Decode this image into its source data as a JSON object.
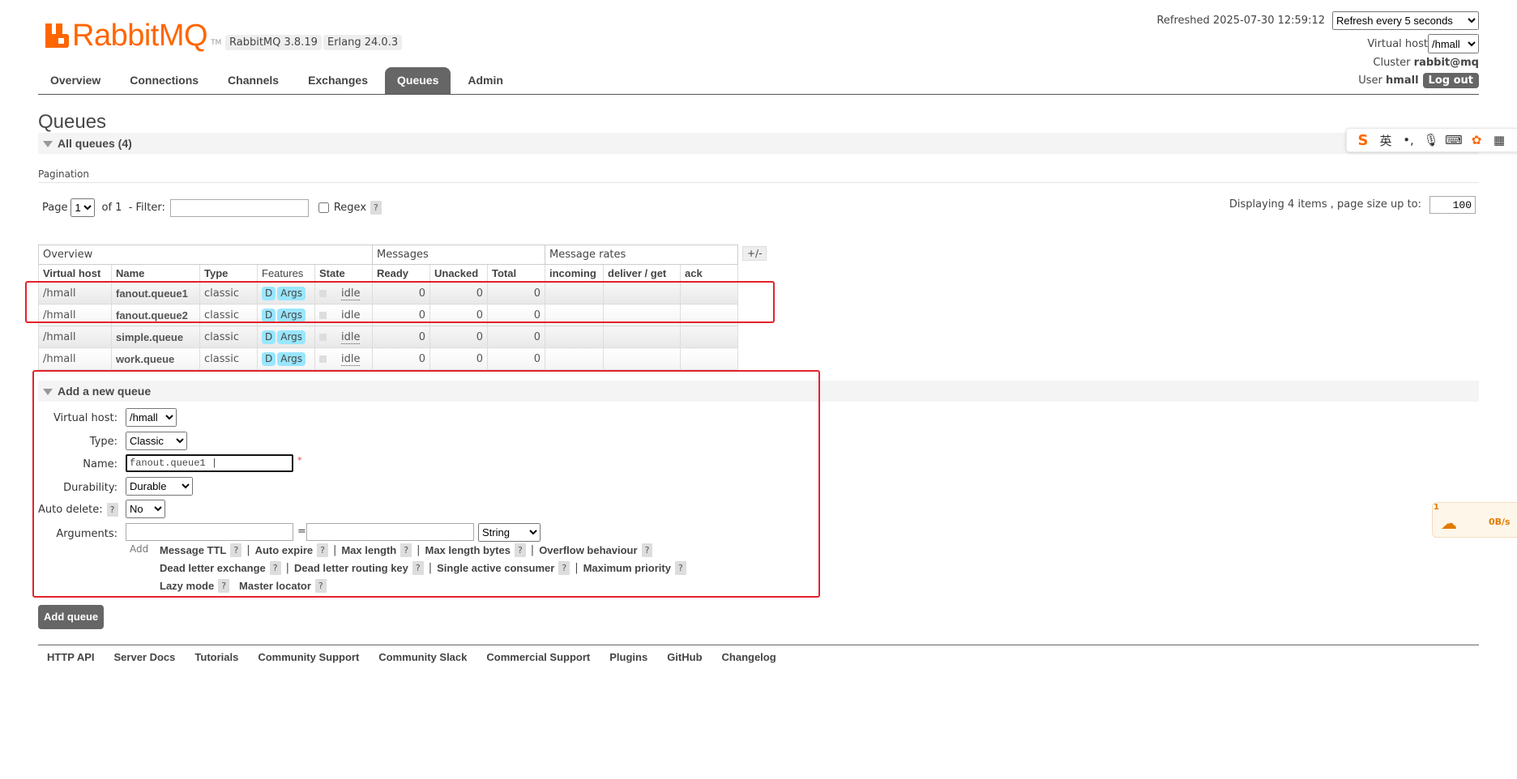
{
  "brand": {
    "name": "RabbitMQ",
    "trademark": "TM",
    "rabbitmq_version": "RabbitMQ 3.8.19",
    "erlang_version": "Erlang 24.0.3",
    "accent_color": "#ff6600"
  },
  "nav": {
    "tabs": [
      {
        "label": "Overview",
        "active": false
      },
      {
        "label": "Connections",
        "active": false
      },
      {
        "label": "Channels",
        "active": false
      },
      {
        "label": "Exchanges",
        "active": false
      },
      {
        "label": "Queues",
        "active": true
      },
      {
        "label": "Admin",
        "active": false
      }
    ]
  },
  "header_right": {
    "refreshed": "Refreshed 2025-07-30 12:59:12",
    "refresh_option": "Refresh every 5 seconds",
    "vhost_label": "Virtual host",
    "vhost_value": "/hmall",
    "cluster_label": "Cluster",
    "cluster_value": "rabbit@mq",
    "user_label": "User",
    "user_value": "hmall",
    "logout_label": "Log out"
  },
  "page": {
    "title": "Queues",
    "all_queues": "All queues (4)"
  },
  "pagination": {
    "label": "Pagination",
    "page_label": "Page",
    "page_value": "1",
    "of_label": "of 1",
    "filter_label": "- Filter:",
    "filter_value": "",
    "regex_label": "Regex",
    "help": "?",
    "displaying": "Displaying 4 items , page size up to:",
    "page_size": "100"
  },
  "table": {
    "group_headers": [
      "Overview",
      "Messages",
      "Message rates"
    ],
    "plus_minus": "+/-",
    "columns": [
      "Virtual host",
      "Name",
      "Type",
      "Features",
      "State",
      "Ready",
      "Unacked",
      "Total",
      "incoming",
      "deliver / get",
      "ack"
    ],
    "feature_d": "D",
    "feature_args": "Args",
    "rows": [
      {
        "vhost": "/hmall",
        "name": "fanout.queue1",
        "type": "classic",
        "state": "idle",
        "ready": "0",
        "unacked": "0",
        "total": "0"
      },
      {
        "vhost": "/hmall",
        "name": "fanout.queue2",
        "type": "classic",
        "state": "idle",
        "ready": "0",
        "unacked": "0",
        "total": "0"
      },
      {
        "vhost": "/hmall",
        "name": "simple.queue",
        "type": "classic",
        "state": "idle",
        "ready": "0",
        "unacked": "0",
        "total": "0"
      },
      {
        "vhost": "/hmall",
        "name": "work.queue",
        "type": "classic",
        "state": "idle",
        "ready": "0",
        "unacked": "0",
        "total": "0"
      }
    ]
  },
  "add_queue": {
    "section_title": "Add a new queue",
    "vhost_label": "Virtual host:",
    "vhost_value": "/hmall",
    "type_label": "Type:",
    "type_value": "Classic",
    "name_label": "Name:",
    "name_value": "fanout.queue1 |",
    "required_mark": "*",
    "durability_label": "Durability:",
    "durability_value": "Durable",
    "auto_delete_label": "Auto delete:",
    "auto_delete_value": "No",
    "arguments_label": "Arguments:",
    "equals": "=",
    "arg_type_value": "String",
    "add_label": "Add",
    "arg_options_row1": [
      "Message TTL",
      "Auto expire",
      "Max length",
      "Max length bytes",
      "Overflow behaviour"
    ],
    "arg_options_row2": [
      "Dead letter exchange",
      "Dead letter routing key",
      "Single active consumer",
      "Maximum priority"
    ],
    "arg_options_row3": [
      "Lazy mode",
      "Master locator"
    ],
    "submit_label": "Add queue"
  },
  "footer": {
    "links": [
      "HTTP API",
      "Server Docs",
      "Tutorials",
      "Community Support",
      "Community Slack",
      "Commercial Support",
      "Plugins",
      "GitHub",
      "Changelog"
    ]
  },
  "ime_toolbar": {
    "icons": [
      "sogou-logo-icon",
      "english-mode-icon",
      "punctuation-icon",
      "microphone-icon",
      "keyboard-icon",
      "skin-icon",
      "grid-menu-icon"
    ],
    "english_glyph": "英"
  },
  "net_widget": {
    "speed": "0B/s",
    "badge": "1"
  },
  "annotation_color": "#e3222b"
}
